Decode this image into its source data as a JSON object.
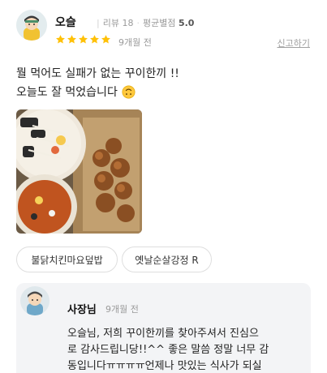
{
  "review": {
    "username": "오슬",
    "review_count_label": "리뷰 18",
    "avg_rating_label": "평균별점",
    "avg_rating_value": "5.0",
    "rating": 5,
    "time_ago": "9개월 전",
    "report_label": "신고하기",
    "text_line1": "뭘 먹어도 실패가 없는 꾸이한끼 !!",
    "text_line2": "오늘도 잘 먹었습니다"
  },
  "menu_tags": [
    "불닭치킨마요덮밥",
    "옛날순살강정 R"
  ],
  "owner_reply": {
    "name": "사장님",
    "time_ago": "9개월 전",
    "lines": [
      "오슬님, 저희 꾸이한끼를 찾아주셔서 진심으",
      "로 감사드립니당!!^^ 좋은 말씀 정말 너무 감",
      "동입니다ㅠㅠㅠㅠ언제나 맛있는 식사가 되실"
    ]
  },
  "colors": {
    "star": "#ffc107",
    "reply_bg": "#f3f4f6",
    "chip_border": "#dedede"
  },
  "icons": {
    "avatar": "user-avatar-icon",
    "star": "star-icon",
    "emoji": "upside-down-face-emoji"
  }
}
